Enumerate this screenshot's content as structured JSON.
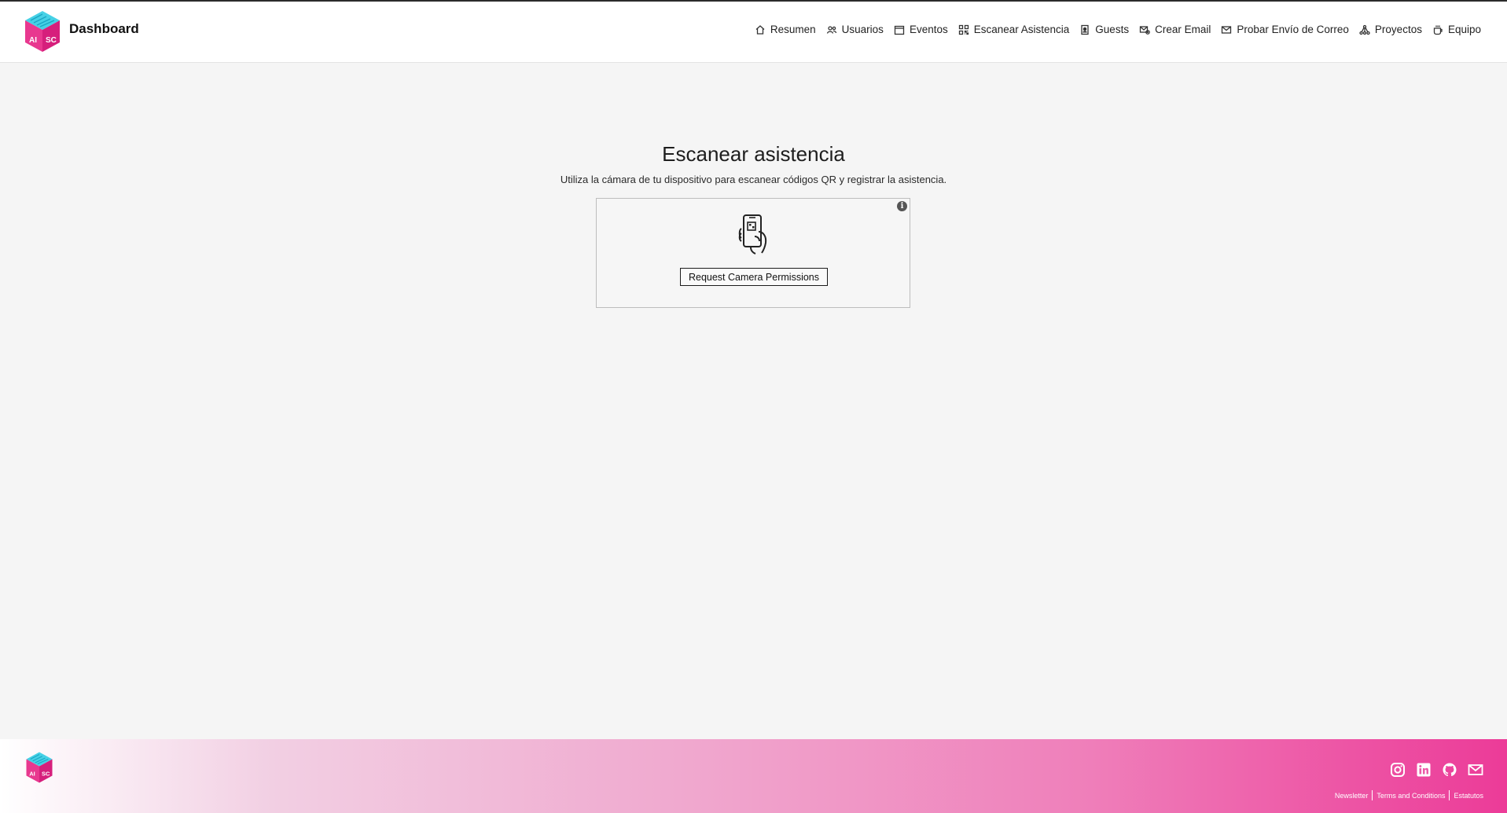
{
  "header": {
    "title": "Dashboard",
    "logo_letters": "AI SC"
  },
  "nav": {
    "items": [
      {
        "label": "Resumen",
        "icon": "home-icon"
      },
      {
        "label": "Usuarios",
        "icon": "users-icon"
      },
      {
        "label": "Eventos",
        "icon": "calendar-icon"
      },
      {
        "label": "Escanear Asistencia",
        "icon": "qr-code-icon"
      },
      {
        "label": "Guests",
        "icon": "id-badge-icon"
      },
      {
        "label": "Crear Email",
        "icon": "email-add-icon"
      },
      {
        "label": "Probar Envío de Correo",
        "icon": "mail-icon"
      },
      {
        "label": "Proyectos",
        "icon": "network-icon"
      },
      {
        "label": "Equipo",
        "icon": "cup-icon"
      }
    ]
  },
  "main": {
    "title": "Escanear asistencia",
    "description": "Utiliza la cámara de tu dispositivo para escanear códigos QR y registrar la asistencia.",
    "scanner": {
      "button_label": "Request Camera Permissions",
      "info_icon": "info-icon",
      "illustration": "phone-qr-scan-icon"
    }
  },
  "footer": {
    "social": [
      "instagram-icon",
      "linkedin-icon",
      "github-icon",
      "mail-icon"
    ],
    "links": [
      "Newsletter",
      "Terms and Conditions",
      "Estatutos"
    ]
  },
  "colors": {
    "brand_pink": "#ec3b98",
    "brand_cyan": "#3fc8e0",
    "background": "#f5f5f5",
    "header_bg": "#ffffff"
  }
}
